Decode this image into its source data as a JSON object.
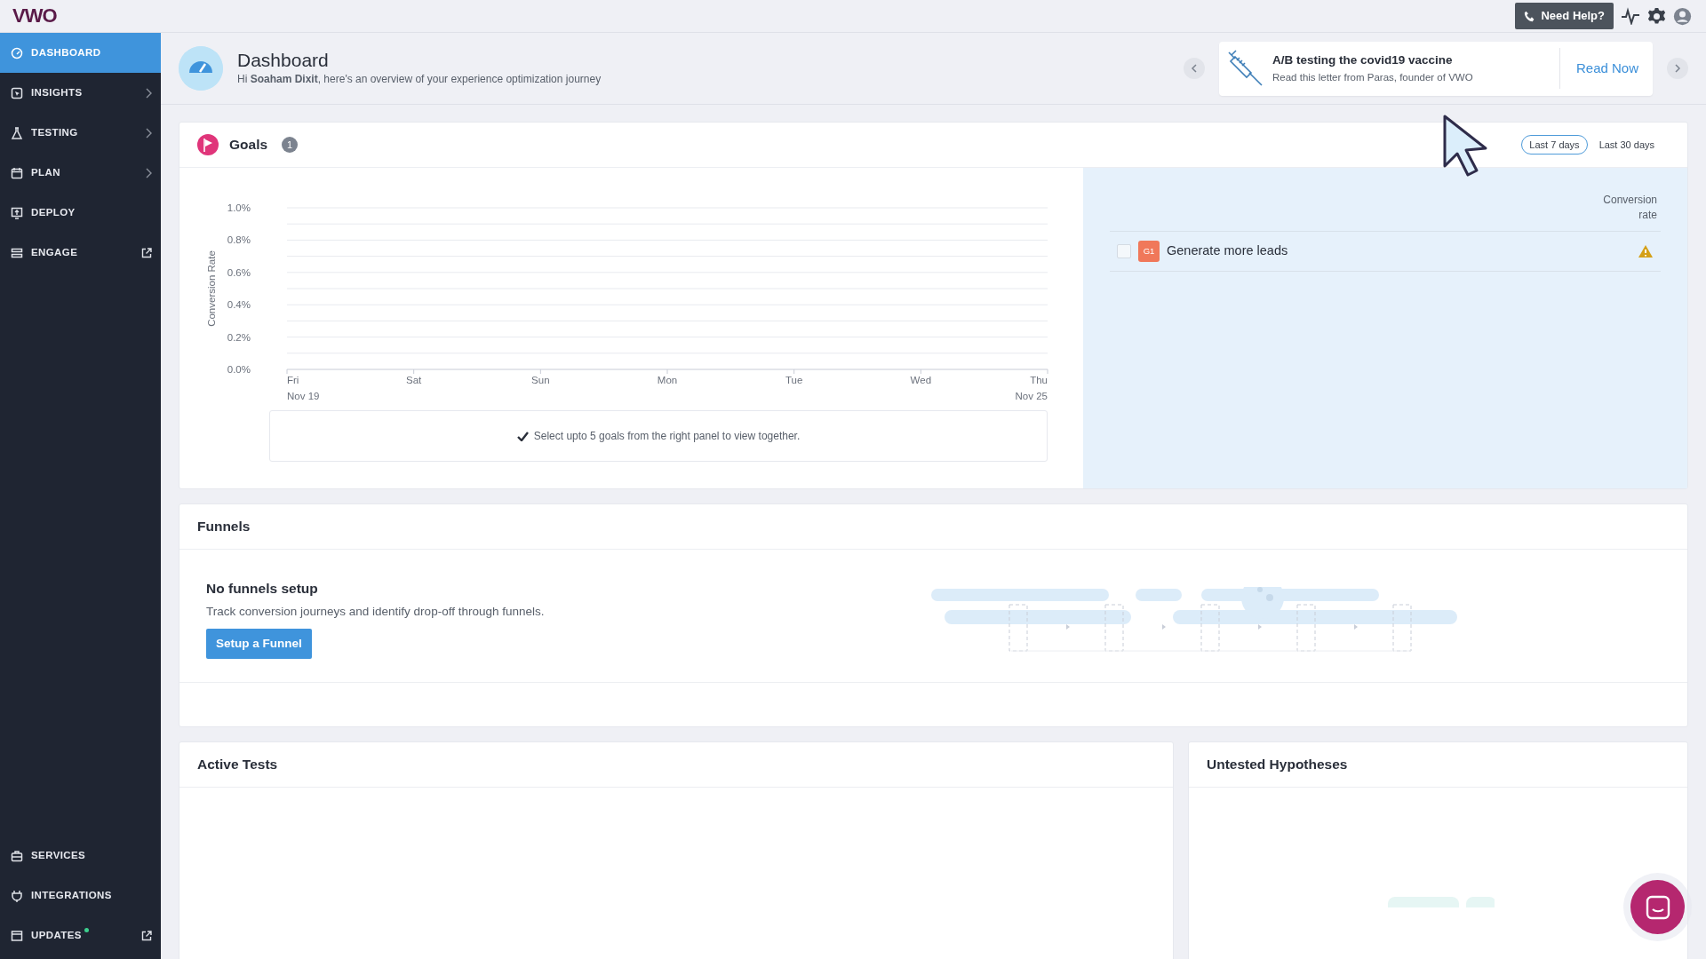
{
  "topbar": {
    "logo": "VWO",
    "help_button": "Need Help?"
  },
  "sidebar": {
    "items": [
      {
        "label": "DASHBOARD",
        "kind": "plain",
        "selected": true
      },
      {
        "label": "INSIGHTS",
        "kind": "chevron",
        "selected": false
      },
      {
        "label": "TESTING",
        "kind": "chevron",
        "selected": false
      },
      {
        "label": "PLAN",
        "kind": "chevron",
        "selected": false
      },
      {
        "label": "DEPLOY",
        "kind": "plain",
        "selected": false
      },
      {
        "label": "ENGAGE",
        "kind": "external",
        "selected": false
      }
    ],
    "bottom_items": [
      {
        "label": "SERVICES",
        "kind": "plain",
        "dot": false,
        "selected": false
      },
      {
        "label": "INTEGRATIONS",
        "kind": "plain",
        "dot": false,
        "selected": false
      },
      {
        "label": "UPDATES",
        "kind": "external",
        "dot": true,
        "selected": false
      }
    ]
  },
  "header": {
    "title": "Dashboard",
    "greeting": "Hi **Soaham Dixit**, here's an overview of your experience optimization journey",
    "banner": {
      "title": "A/B testing the covid19 vaccine",
      "subtitle": "Read this letter from Paras, founder of VWO",
      "link": "Read Now"
    }
  },
  "goals": {
    "title": "Goals",
    "count": "1",
    "ranges": [
      {
        "label": "Last 7 days",
        "selected": true
      },
      {
        "label": "Last 30 days",
        "selected": false
      }
    ],
    "chart_data": {
      "type": "line",
      "grid": true,
      "ylabel": "Conversion Rate",
      "categories": [
        "Fri\nNov 19",
        "Sat",
        "Sun",
        "Mon",
        "Tue",
        "Wed",
        "Thu\nNov 25"
      ],
      "ylim": [
        0,
        1
      ],
      "yticks": [
        {
          "value": 0,
          "label": "0.0%"
        },
        {
          "value": 0.2,
          "label": "0.2%"
        },
        {
          "value": 0.4,
          "label": "0.4%"
        },
        {
          "value": 0.6,
          "label": "0.6%"
        },
        {
          "value": 0.8,
          "label": "0.8%"
        },
        {
          "value": 1,
          "label": "1.0%"
        }
      ]
    },
    "hint": "Select upto 5 goals from the right panel to view together.",
    "column_header": "Conversion rate",
    "items": [
      {
        "tag": "G1",
        "color": "#f0785a",
        "name": "Generate more leads",
        "checked": false,
        "warning": true
      }
    ]
  },
  "funnels": {
    "title": "Funnels",
    "empty_title": "No funnels setup",
    "empty_text": "Track conversion journeys and identify drop-off through funnels.",
    "button": "Setup a Funnel"
  },
  "active_tests": {
    "title": "Active Tests"
  },
  "hypotheses": {
    "title": "Untested Hypotheses"
  }
}
